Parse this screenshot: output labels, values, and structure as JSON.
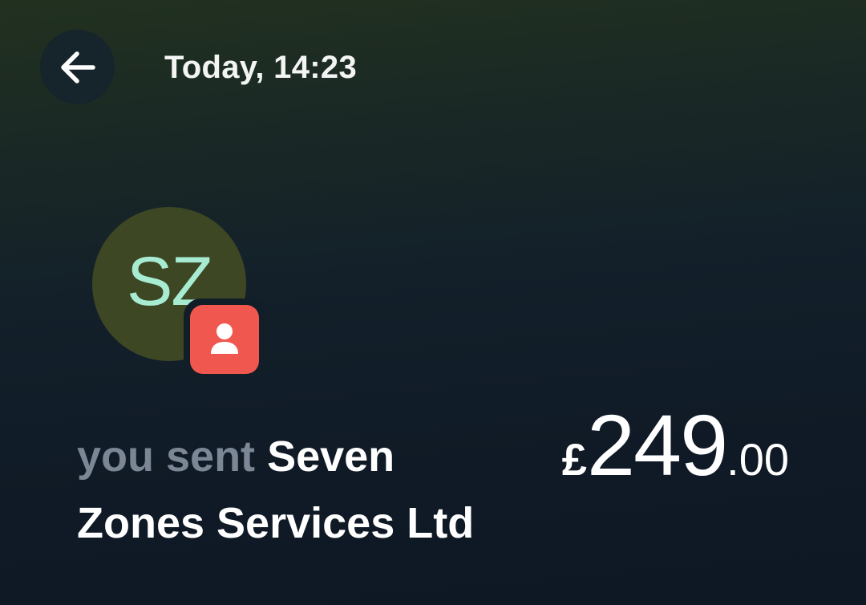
{
  "header": {
    "back_icon": "arrow-left-icon",
    "timestamp": "Today, 14:23"
  },
  "transaction": {
    "avatar_initials": "SZ",
    "badge_icon": "person-icon",
    "direction_text": "you sent",
    "counterparty": "Seven Zones Services Ltd",
    "amount": {
      "currency_symbol": "£",
      "major": "249",
      "minor": ".00"
    }
  },
  "colors": {
    "avatar_bg": "#3d4724",
    "avatar_text": "#a7ecd2",
    "badge_bg": "#f0574e",
    "muted_text": "#7b8795"
  }
}
